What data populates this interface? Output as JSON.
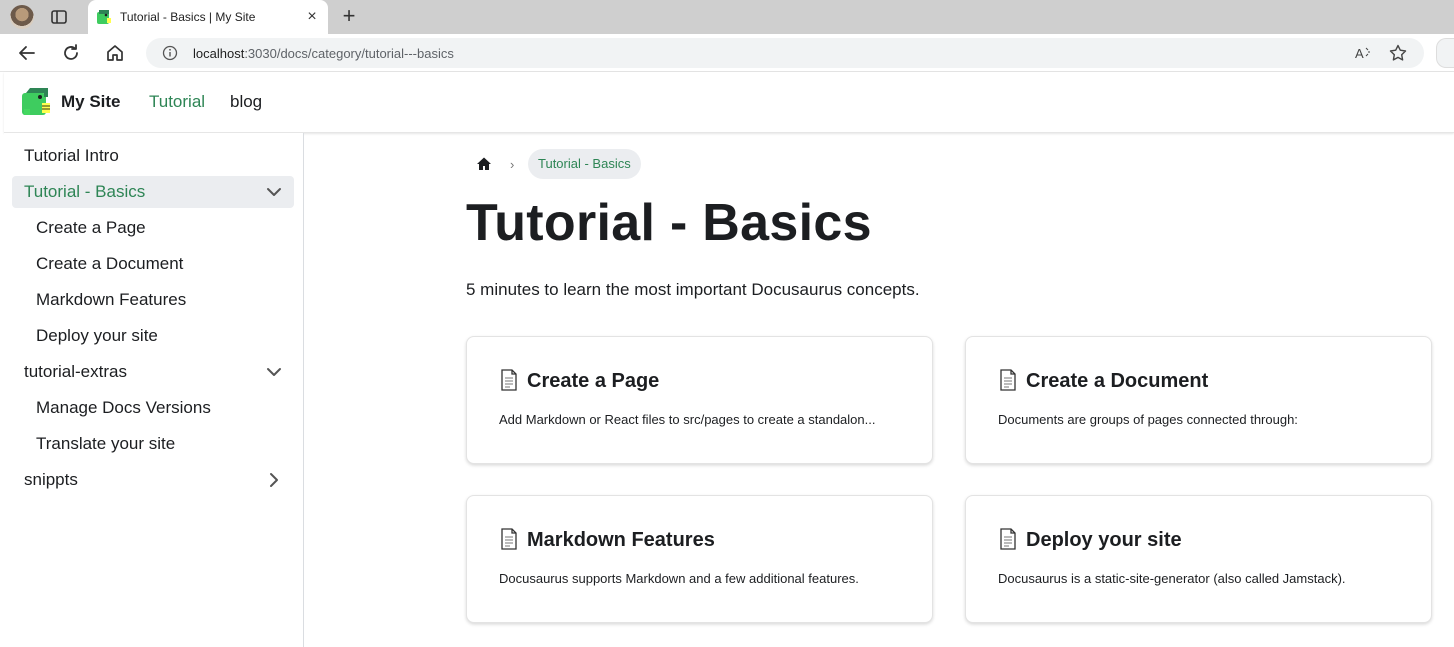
{
  "browser": {
    "tab_title": "Tutorial - Basics | My Site",
    "url_host": "localhost",
    "url_rest": ":3030/docs/category/tutorial---basics",
    "tab_close_glyph": "×",
    "new_tab_glyph": "+"
  },
  "navbar": {
    "brand": "My Site",
    "links": [
      {
        "label": "Tutorial",
        "active": true
      },
      {
        "label": "blog",
        "active": false
      }
    ]
  },
  "sidebar": {
    "items": [
      {
        "label": "Tutorial Intro",
        "level": 1
      },
      {
        "label": "Tutorial - Basics",
        "level": 1,
        "active": true,
        "caret": "down"
      },
      {
        "label": "Create a Page",
        "level": 2
      },
      {
        "label": "Create a Document",
        "level": 2
      },
      {
        "label": "Markdown Features",
        "level": 2
      },
      {
        "label": "Deploy your site",
        "level": 2
      },
      {
        "label": "tutorial-extras",
        "level": 1,
        "caret": "down"
      },
      {
        "label": "Manage Docs Versions",
        "level": 2
      },
      {
        "label": "Translate your site",
        "level": 2
      },
      {
        "label": "snippts",
        "level": 1,
        "caret": "right"
      }
    ]
  },
  "breadcrumb": {
    "current": "Tutorial - Basics",
    "separator": "›"
  },
  "page": {
    "title": "Tutorial - Basics",
    "description": "5 minutes to learn the most important Docusaurus concepts."
  },
  "cards": [
    {
      "title": "Create a Page",
      "description": "Add Markdown or React files to src/pages to create a standalon..."
    },
    {
      "title": "Create a Document",
      "description": "Documents are groups of pages connected through:"
    },
    {
      "title": "Markdown Features",
      "description": "Docusaurus supports Markdown and a few additional features."
    },
    {
      "title": "Deploy your site",
      "description": "Docusaurus is a static-site-generator (also called Jamstack)."
    }
  ],
  "colors": {
    "primary": "#2e8555",
    "text": "#1c1e21",
    "active_bg": "#ebedf0"
  }
}
